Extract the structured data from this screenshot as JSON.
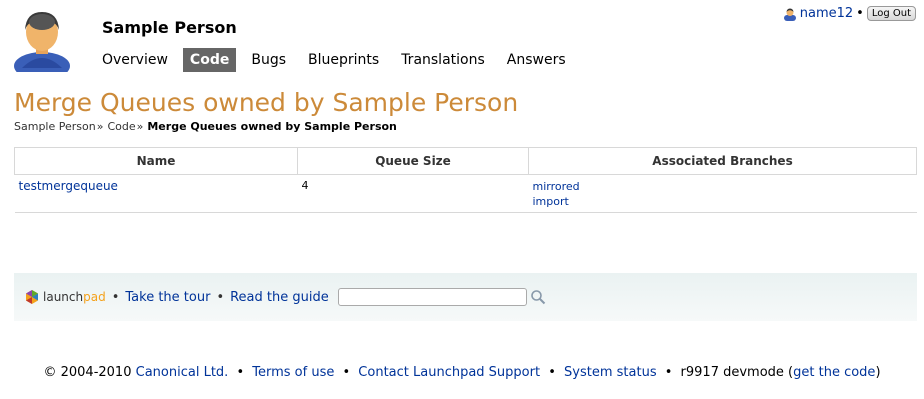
{
  "header": {
    "person_name": "Sample Person",
    "tabs": [
      {
        "label": "Overview",
        "active": false
      },
      {
        "label": "Code",
        "active": true
      },
      {
        "label": "Bugs",
        "active": false
      },
      {
        "label": "Blueprints",
        "active": false
      },
      {
        "label": "Translations",
        "active": false
      },
      {
        "label": "Answers",
        "active": false
      }
    ]
  },
  "login": {
    "user_name": "name12",
    "bullet": "•",
    "logout_label": "Log Out"
  },
  "page": {
    "title": "Merge Queues owned by Sample Person",
    "breadcrumbs": [
      "Sample Person",
      "Code"
    ],
    "breadcrumb_sep": "»",
    "breadcrumb_current": "Merge Queues owned by Sample Person"
  },
  "table": {
    "headers": [
      "Name",
      "Queue Size",
      "Associated Branches"
    ],
    "rows": [
      {
        "name": "testmergequeue",
        "queue_size": "4",
        "branches": [
          "mirrored",
          "import"
        ]
      }
    ]
  },
  "footer": {
    "logo_text_a": "launch",
    "logo_text_b": "pad",
    "bullet": "•",
    "tour_link": "Take the tour",
    "guide_link": "Read the guide",
    "search_value": ""
  },
  "copyright": {
    "prefix": "© 2004-2010",
    "canonical": "Canonical Ltd.",
    "terms": "Terms of use",
    "contact": "Contact Launchpad Support",
    "status": "System status",
    "revision": "r9917 devmode (",
    "get_code": "get the code",
    "suffix": ")",
    "bullet": "•"
  },
  "colors": {
    "title": "#cc8a39",
    "link": "#003399",
    "active_tab": "#666666",
    "logo_accent": "#f4a21c"
  },
  "icons": {
    "avatar": "person-avatar-icon",
    "user": "person-icon",
    "logo": "launchpad-logo-icon",
    "search": "search-icon"
  }
}
